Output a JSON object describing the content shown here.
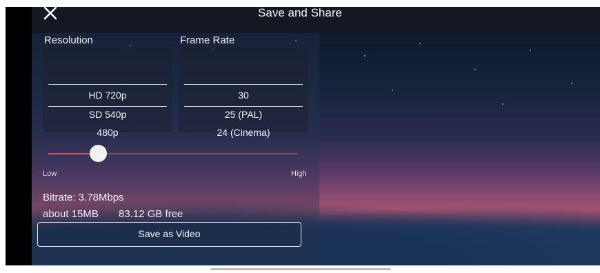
{
  "header": {
    "title": "Save and Share",
    "close_icon": "close-icon"
  },
  "resolution": {
    "label": "Resolution",
    "options": [
      "HD 720p",
      "SD 540p",
      "480p"
    ],
    "selected": "HD 720p"
  },
  "frame_rate": {
    "label": "Frame Rate",
    "options": [
      "30",
      "25 (PAL)",
      "24 (Cinema)"
    ],
    "selected": "30"
  },
  "quality_slider": {
    "min_label": "Low",
    "max_label": "High",
    "value": 0.2
  },
  "stats": {
    "bitrate": "Bitrate: 3.78Mbps",
    "size": "about 15MB",
    "free": "83.12 GB free"
  },
  "save_button": {
    "label": "Save as Video"
  },
  "colors": {
    "accent": "#e05060",
    "topbar": "#151823"
  }
}
